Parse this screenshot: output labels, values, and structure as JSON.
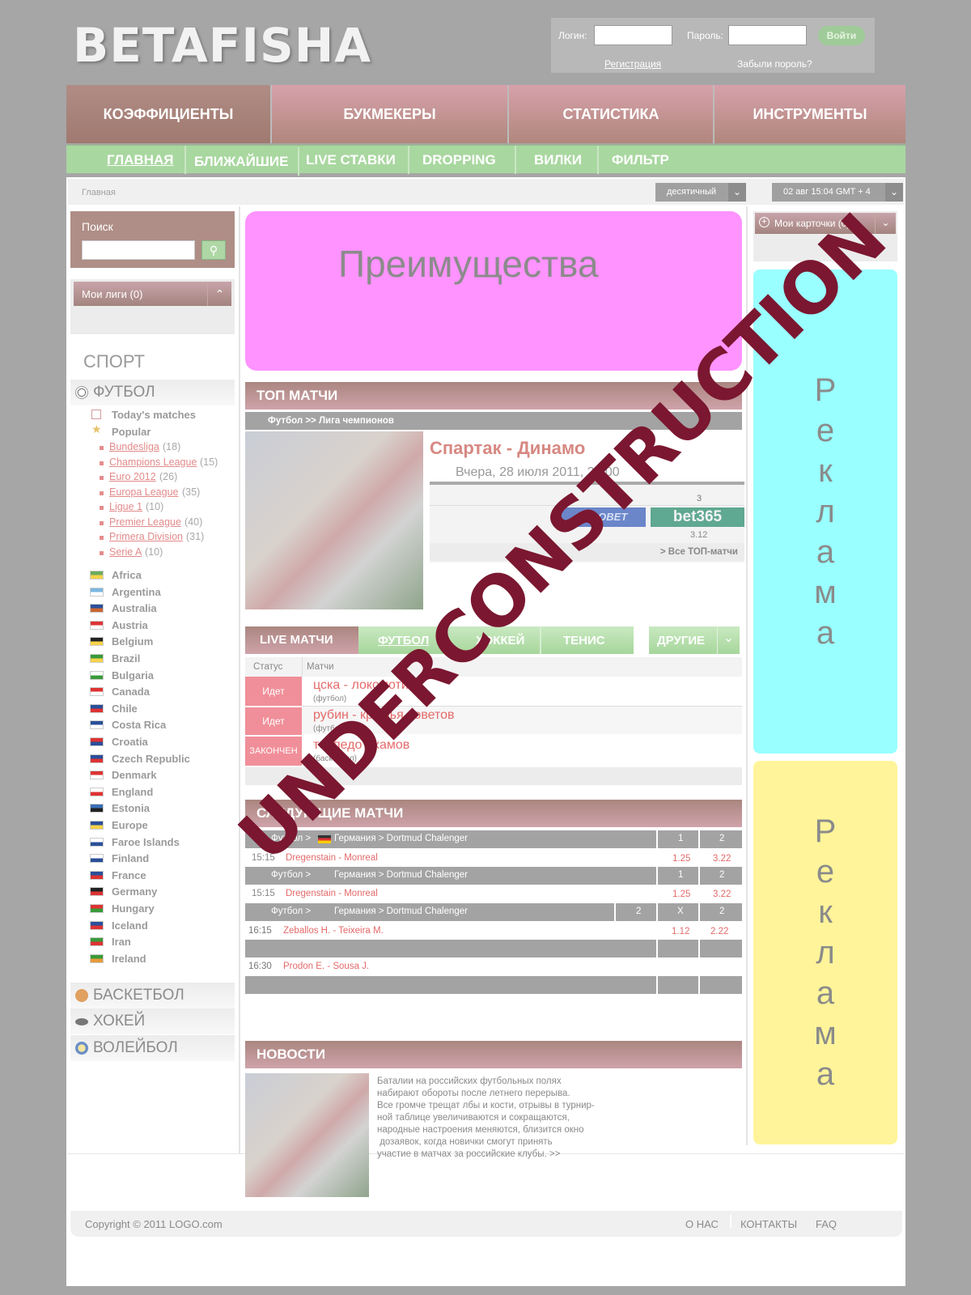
{
  "header": {
    "logo": "BETAFISHA",
    "login_label": "Логин:",
    "password_label": "Пароль:",
    "login_button": "Войти",
    "register_link": "Регистрация",
    "forgot_link": "Забыли пороль?"
  },
  "main_nav": [
    "КОЭФФИЦИЕНТЫ",
    "БУКМЕКЕРЫ",
    "СТАТИСТИКА",
    "ИНСТРУМЕНТЫ"
  ],
  "sub_nav": [
    "ГЛАВНАЯ",
    "БЛИЖАЙШИЕ",
    "LIVE СТАВКИ",
    "DROPPING",
    "ВИЛКИ",
    "ФИЛЬТР"
  ],
  "breadcrumb": "Главная",
  "odds_format": "десятичный",
  "datetime": "02 авг 15:04 GMT + 4",
  "search": {
    "title": "Поиск"
  },
  "my_leagues": "Мои лиги (0)",
  "sport_title": "СПОРТ",
  "football": {
    "label": "ФУТБОЛ",
    "today": "Today's matches",
    "popular": "Popular",
    "leagues": [
      {
        "name": "Bundesliga",
        "count": "(18)"
      },
      {
        "name": "Champions League",
        "count": "(15)"
      },
      {
        "name": "Euro 2012",
        "count": "(26)"
      },
      {
        "name": "Europa League",
        "count": "(35)"
      },
      {
        "name": "Ligue 1",
        "count": "(10)"
      },
      {
        "name": "Premier League",
        "count": "(40)"
      },
      {
        "name": "Primera Division",
        "count": "(31)"
      },
      {
        "name": "Serie A",
        "count": "(10)"
      }
    ],
    "countries": [
      "Africa",
      "Argentina",
      "Australia",
      "Austria",
      "Belgium",
      "Brazil",
      "Bulgaria",
      "Canada",
      "Chile",
      "Costa Rica",
      "Croatia",
      "Czech Republic",
      "Denmark",
      "England",
      "Estonia",
      "Europe",
      "Faroe Islands",
      "Finland",
      "France",
      "Germany",
      "Hungary",
      "Iceland",
      "Iran",
      "Ireland"
    ]
  },
  "other_sports": [
    "БАСКЕТБОЛ",
    "ХОКЕЙ",
    "ВОЛЕЙБОЛ"
  ],
  "banner": "Преимущества",
  "top_matches": {
    "title": "ТОП МАТЧИ",
    "path": "Футбол >> Лига чемпионов",
    "match": "Спартак - Динамо",
    "date": "Вчера, 28 июля 2011, 22:00",
    "col3": "3",
    "bookmaker1": "EUROBET",
    "bookmaker2": "bet365",
    "odd": "3.12",
    "all_link": "> Все ТОП-матчи"
  },
  "live": {
    "title": "LIVE МАТЧИ",
    "tabs": [
      "ФУТБОЛ",
      "ХОККЕЙ",
      "ТЕНИС"
    ],
    "others": "ДРУГИЕ",
    "col_status": "Статус",
    "col_matches": "Матчи",
    "rows": [
      {
        "status": "Идет",
        "match": "цска - локомотив",
        "sport": "(футбол)"
      },
      {
        "status": "Идет",
        "match": "рубин - крылья советов",
        "sport": "(футбол)"
      },
      {
        "status": "ЗАКОНЧЕН",
        "match": "торпедо - камов",
        "sport": "(баскетбол)"
      }
    ]
  },
  "next": {
    "title": "СЛЕДУЮЩИЕ МАТЧИ",
    "groups": [
      {
        "path": "Футбол >",
        "league": "Германия > Dortmud Chalenger",
        "h1": "1",
        "h2": "2",
        "time": "15:15",
        "match": "Dregenstain - Monreal",
        "o1": "1.25",
        "o2": "3.22"
      },
      {
        "path": "Футбол >",
        "league": "Германия > Dortmud Chalenger",
        "h1": "1",
        "h2": "2",
        "time": "15:15",
        "match": "Dregenstain - Monreal",
        "o1": "1.25",
        "o2": "3.22"
      }
    ],
    "group3": {
      "path": "Футбол >",
      "league": "Германия > Dortmud Chalenger",
      "h0": "2",
      "h1": "X",
      "h2": "2"
    },
    "row_a": {
      "time": "16:15",
      "match": "Zeballos H. - Teixeira M.",
      "o1": "1.12",
      "o2": "2.22"
    },
    "row_b": {
      "time": "16:30",
      "match": "Prodon E. - Sousa J."
    }
  },
  "news": {
    "title": "НОВОСТИ",
    "lines": [
      "Баталии на российских футбольных полях",
      "набирают обороты после летнего перерыва.",
      "Все громче трещат лбы и кости, отрывы в турнир-",
      "ной таблице увеличиваются и сокращаются,",
      "народные настроения меняются, близится окно",
      " дозаявок, когда новички смогут принять",
      "участие в матчах за российские клубы."
    ],
    "more": ">>"
  },
  "my_cards": "Мои карточки (0)",
  "ad_text": [
    "Р",
    "е",
    "к",
    "л",
    "а",
    "м",
    "а"
  ],
  "footer": {
    "copyright": "Copyright © 2011 LOGO.com",
    "links": [
      "О НАС",
      "КОНТАКТЫ",
      "FAQ"
    ]
  },
  "watermark": "UNDERCONSTRUCTION",
  "colors": {
    "banner": "#ff93ff",
    "ad_top": "#99ffff",
    "ad_bottom": "#fff49a",
    "watermark": "#7b1730"
  }
}
